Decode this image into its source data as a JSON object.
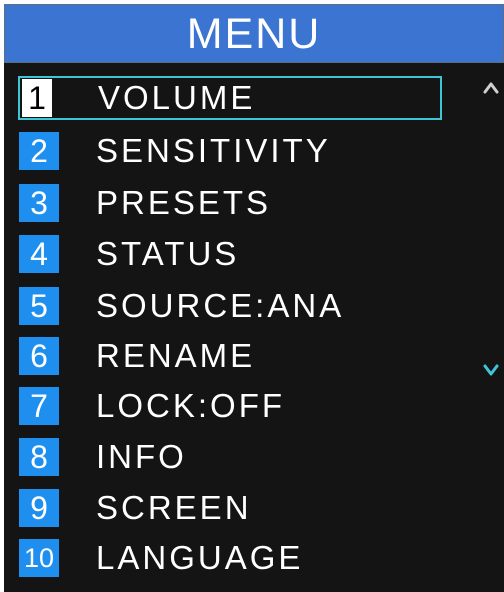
{
  "header": {
    "title": "MENU"
  },
  "menu": {
    "items": [
      {
        "number": "1",
        "label": "VOLUME",
        "selected": true
      },
      {
        "number": "2",
        "label": "SENSITIVITY",
        "selected": false
      },
      {
        "number": "3",
        "label": "PRESETS",
        "selected": false
      },
      {
        "number": "4",
        "label": "STATUS",
        "selected": false
      },
      {
        "number": "5",
        "label": "SOURCE:ANA",
        "selected": false
      },
      {
        "number": "6",
        "label": "RENAME",
        "selected": false
      },
      {
        "number": "7",
        "label": "LOCK:OFF",
        "selected": false
      },
      {
        "number": "8",
        "label": "INFO",
        "selected": false
      },
      {
        "number": "9",
        "label": "SCREEN",
        "selected": false
      },
      {
        "number": "10",
        "label": "LANGUAGE",
        "selected": false
      }
    ]
  },
  "scroll": {
    "up_icon": "chevron-up-icon",
    "down_icon": "chevron-down-icon",
    "up_color": "#d0d0d0",
    "down_color": "#3ec6d8"
  },
  "colors": {
    "title_bar": "#3c74d2",
    "background": "#141414",
    "number_badge": "#1f8fef",
    "selection_border": "#3ec6d8"
  }
}
